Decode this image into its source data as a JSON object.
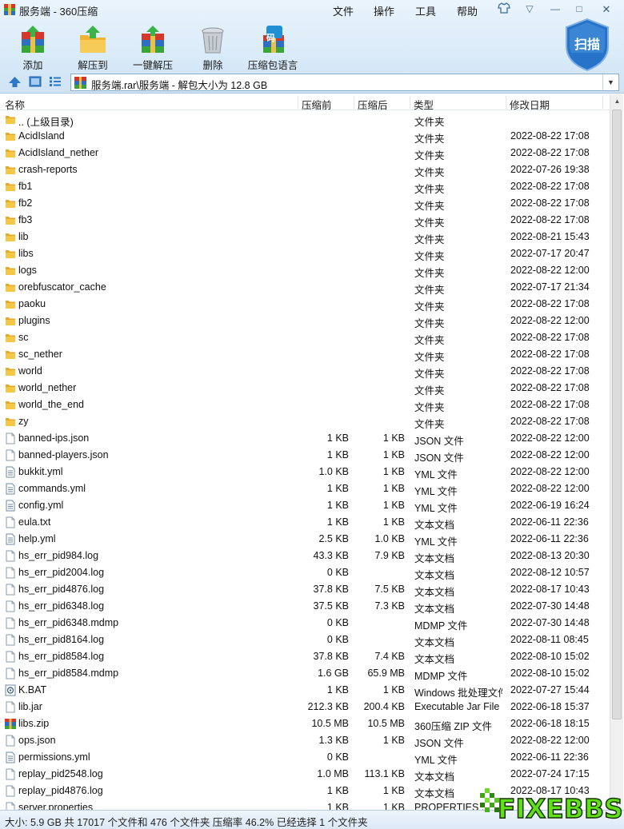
{
  "window": {
    "title": "服务端 - 360压缩",
    "menu": [
      "文件",
      "操作",
      "工具",
      "帮助"
    ],
    "controls": {
      "shirt": "skin-icon",
      "dropdown": "▽",
      "minimize": "—",
      "maximize": "□",
      "close": "✕"
    }
  },
  "toolbar": {
    "add": "添加",
    "extract_to": "解压到",
    "one_click_extract": "一键解压",
    "delete": "删除",
    "archive_lang": "压缩包语言",
    "lang_badge": "码",
    "scan": "扫描"
  },
  "address": {
    "path": "服务端.rar\\服务端 - 解包大小为 12.8 GB",
    "dropdown": "▼"
  },
  "columns": {
    "name": "名称",
    "original": "压缩前",
    "compressed": "压缩后",
    "type": "类型",
    "modified": "修改日期"
  },
  "rows": [
    {
      "name": ".. (上级目录)",
      "orig": "",
      "comp": "",
      "type": "文件夹",
      "date": "",
      "icon": "folder"
    },
    {
      "name": "AcidIsland",
      "orig": "",
      "comp": "",
      "type": "文件夹",
      "date": "2022-08-22 17:08",
      "icon": "folder"
    },
    {
      "name": "AcidIsland_nether",
      "orig": "",
      "comp": "",
      "type": "文件夹",
      "date": "2022-08-22 17:08",
      "icon": "folder"
    },
    {
      "name": "crash-reports",
      "orig": "",
      "comp": "",
      "type": "文件夹",
      "date": "2022-07-26 19:38",
      "icon": "folder"
    },
    {
      "name": "fb1",
      "orig": "",
      "comp": "",
      "type": "文件夹",
      "date": "2022-08-22 17:08",
      "icon": "folder"
    },
    {
      "name": "fb2",
      "orig": "",
      "comp": "",
      "type": "文件夹",
      "date": "2022-08-22 17:08",
      "icon": "folder"
    },
    {
      "name": "fb3",
      "orig": "",
      "comp": "",
      "type": "文件夹",
      "date": "2022-08-22 17:08",
      "icon": "folder"
    },
    {
      "name": "lib",
      "orig": "",
      "comp": "",
      "type": "文件夹",
      "date": "2022-08-21 15:43",
      "icon": "folder"
    },
    {
      "name": "libs",
      "orig": "",
      "comp": "",
      "type": "文件夹",
      "date": "2022-07-17 20:47",
      "icon": "folder"
    },
    {
      "name": "logs",
      "orig": "",
      "comp": "",
      "type": "文件夹",
      "date": "2022-08-22 12:00",
      "icon": "folder"
    },
    {
      "name": "orebfuscator_cache",
      "orig": "",
      "comp": "",
      "type": "文件夹",
      "date": "2022-07-17 21:34",
      "icon": "folder"
    },
    {
      "name": "paoku",
      "orig": "",
      "comp": "",
      "type": "文件夹",
      "date": "2022-08-22 17:08",
      "icon": "folder"
    },
    {
      "name": "plugins",
      "orig": "",
      "comp": "",
      "type": "文件夹",
      "date": "2022-08-22 12:00",
      "icon": "folder"
    },
    {
      "name": "sc",
      "orig": "",
      "comp": "",
      "type": "文件夹",
      "date": "2022-08-22 17:08",
      "icon": "folder"
    },
    {
      "name": "sc_nether",
      "orig": "",
      "comp": "",
      "type": "文件夹",
      "date": "2022-08-22 17:08",
      "icon": "folder"
    },
    {
      "name": "world",
      "orig": "",
      "comp": "",
      "type": "文件夹",
      "date": "2022-08-22 17:08",
      "icon": "folder"
    },
    {
      "name": "world_nether",
      "orig": "",
      "comp": "",
      "type": "文件夹",
      "date": "2022-08-22 17:08",
      "icon": "folder"
    },
    {
      "name": "world_the_end",
      "orig": "",
      "comp": "",
      "type": "文件夹",
      "date": "2022-08-22 17:08",
      "icon": "folder"
    },
    {
      "name": "zy",
      "orig": "",
      "comp": "",
      "type": "文件夹",
      "date": "2022-08-22 17:08",
      "icon": "folder"
    },
    {
      "name": "banned-ips.json",
      "orig": "1 KB",
      "comp": "1 KB",
      "type": "JSON 文件",
      "date": "2022-08-22 12:00",
      "icon": "file"
    },
    {
      "name": "banned-players.json",
      "orig": "1 KB",
      "comp": "1 KB",
      "type": "JSON 文件",
      "date": "2022-08-22 12:00",
      "icon": "file"
    },
    {
      "name": "bukkit.yml",
      "orig": "1.0 KB",
      "comp": "1 KB",
      "type": "YML 文件",
      "date": "2022-08-22 12:00",
      "icon": "textfile"
    },
    {
      "name": "commands.yml",
      "orig": "1 KB",
      "comp": "1 KB",
      "type": "YML 文件",
      "date": "2022-08-22 12:00",
      "icon": "textfile"
    },
    {
      "name": "config.yml",
      "orig": "1 KB",
      "comp": "1 KB",
      "type": "YML 文件",
      "date": "2022-06-19 16:24",
      "icon": "textfile"
    },
    {
      "name": "eula.txt",
      "orig": "1 KB",
      "comp": "1 KB",
      "type": "文本文档",
      "date": "2022-06-11 22:36",
      "icon": "file"
    },
    {
      "name": "help.yml",
      "orig": "2.5 KB",
      "comp": "1.0 KB",
      "type": "YML 文件",
      "date": "2022-06-11 22:36",
      "icon": "textfile"
    },
    {
      "name": "hs_err_pid984.log",
      "orig": "43.3 KB",
      "comp": "7.9 KB",
      "type": "文本文档",
      "date": "2022-08-13 20:30",
      "icon": "file"
    },
    {
      "name": "hs_err_pid2004.log",
      "orig": "0 KB",
      "comp": "",
      "type": "文本文档",
      "date": "2022-08-12 10:57",
      "icon": "file"
    },
    {
      "name": "hs_err_pid4876.log",
      "orig": "37.8 KB",
      "comp": "7.5 KB",
      "type": "文本文档",
      "date": "2022-08-17 10:43",
      "icon": "file"
    },
    {
      "name": "hs_err_pid6348.log",
      "orig": "37.5 KB",
      "comp": "7.3 KB",
      "type": "文本文档",
      "date": "2022-07-30 14:48",
      "icon": "file"
    },
    {
      "name": "hs_err_pid6348.mdmp",
      "orig": "0 KB",
      "comp": "",
      "type": "MDMP 文件",
      "date": "2022-07-30 14:48",
      "icon": "file"
    },
    {
      "name": "hs_err_pid8164.log",
      "orig": "0 KB",
      "comp": "",
      "type": "文本文档",
      "date": "2022-08-11 08:45",
      "icon": "file"
    },
    {
      "name": "hs_err_pid8584.log",
      "orig": "37.8 KB",
      "comp": "7.4 KB",
      "type": "文本文档",
      "date": "2022-08-10 15:02",
      "icon": "file"
    },
    {
      "name": "hs_err_pid8584.mdmp",
      "orig": "1.6 GB",
      "comp": "65.9 MB",
      "type": "MDMP 文件",
      "date": "2022-08-10 15:02",
      "icon": "file"
    },
    {
      "name": "K.BAT",
      "orig": "1 KB",
      "comp": "1 KB",
      "type": "Windows 批处理文件",
      "date": "2022-07-27 15:44",
      "icon": "bat"
    },
    {
      "name": "lib.jar",
      "orig": "212.3 KB",
      "comp": "200.4 KB",
      "type": "Executable Jar File",
      "date": "2022-06-18 15:37",
      "icon": "file"
    },
    {
      "name": "libs.zip",
      "orig": "10.5 MB",
      "comp": "10.5 MB",
      "type": "360压缩 ZIP 文件",
      "date": "2022-06-18 18:15",
      "icon": "zip"
    },
    {
      "name": "ops.json",
      "orig": "1.3 KB",
      "comp": "1 KB",
      "type": "JSON 文件",
      "date": "2022-08-22 12:00",
      "icon": "file"
    },
    {
      "name": "permissions.yml",
      "orig": "0 KB",
      "comp": "",
      "type": "YML 文件",
      "date": "2022-06-11 22:36",
      "icon": "textfile"
    },
    {
      "name": "replay_pid2548.log",
      "orig": "1.0 MB",
      "comp": "113.1 KB",
      "type": "文本文档",
      "date": "2022-07-24 17:15",
      "icon": "file"
    },
    {
      "name": "replay_pid4876.log",
      "orig": "1 KB",
      "comp": "1 KB",
      "type": "文本文档",
      "date": "2022-08-17 10:43",
      "icon": "file"
    },
    {
      "name": "server.properties",
      "orig": "1 KB",
      "comp": "1 KB",
      "type": "PROPERTIES ...",
      "date": "",
      "icon": "file"
    }
  ],
  "status": "大小: 5.9 GB 共 17017 个文件和 476 个文件夹 压缩率 46.2% 已经选择 1 个文件夹",
  "watermark": "FIXEBBS",
  "colors": {
    "folder": "#f2b931",
    "chrome": "#d7e9f8",
    "accent": "#2f78c4"
  }
}
